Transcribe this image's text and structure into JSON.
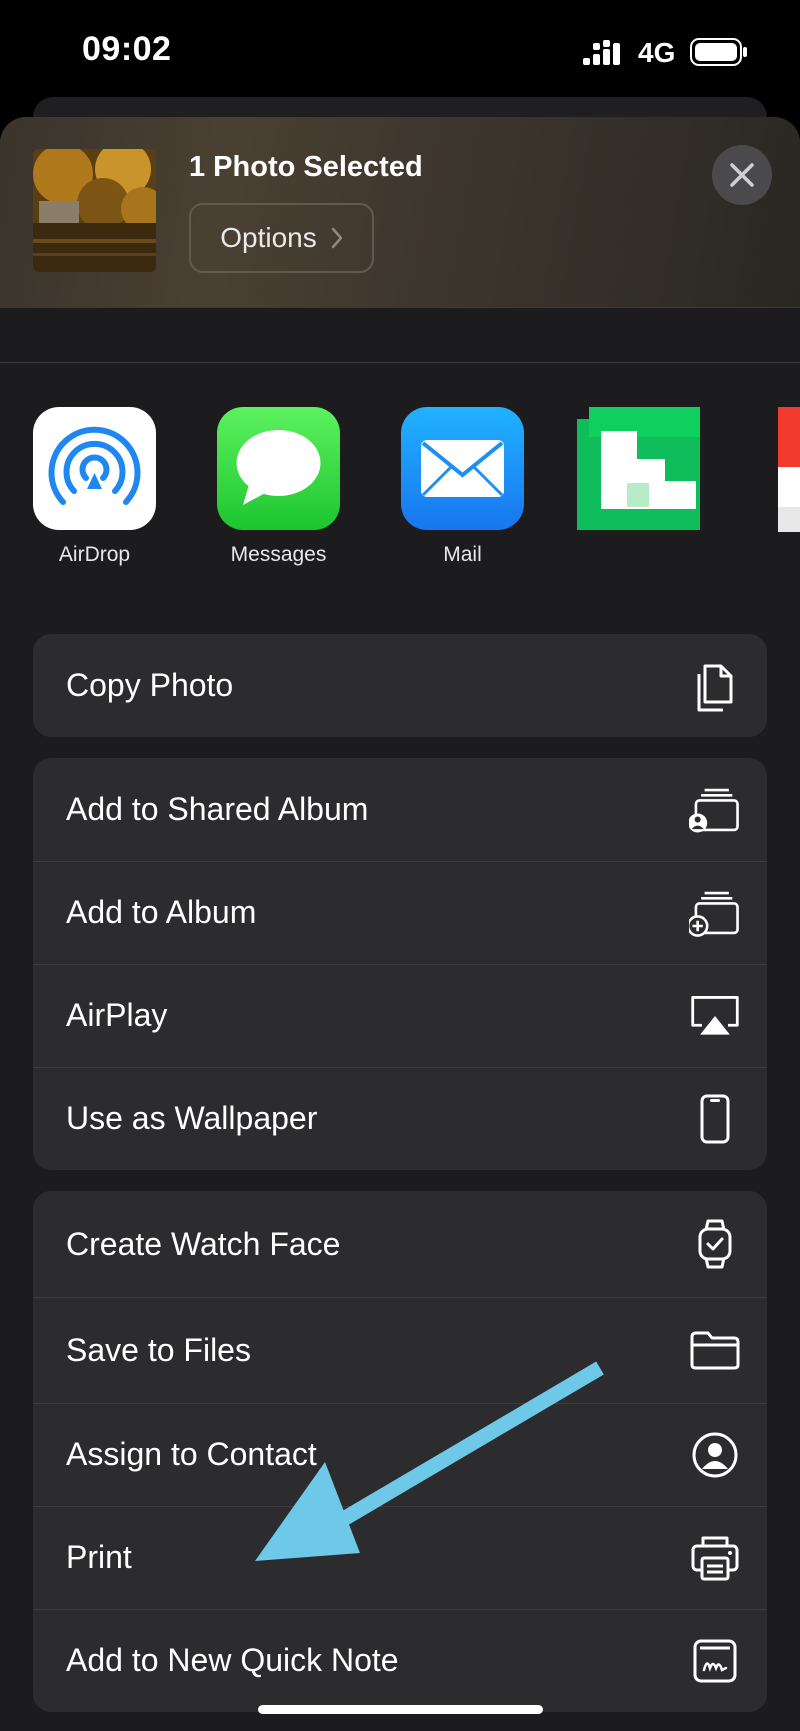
{
  "status": {
    "time": "09:02",
    "network": "4G"
  },
  "header": {
    "title": "1 Photo Selected",
    "options_label": "Options"
  },
  "apps": [
    {
      "label": "AirDrop",
      "icon": "airdrop-icon"
    },
    {
      "label": "Messages",
      "icon": "messages-icon"
    },
    {
      "label": "Mail",
      "icon": "mail-icon"
    }
  ],
  "groups": [
    [
      {
        "label": "Copy Photo",
        "icon": "copy-icon"
      }
    ],
    [
      {
        "label": "Add to Shared Album",
        "icon": "shared-album-icon"
      },
      {
        "label": "Add to Album",
        "icon": "add-album-icon"
      },
      {
        "label": "AirPlay",
        "icon": "airplay-icon"
      },
      {
        "label": "Use as Wallpaper",
        "icon": "phone-icon"
      }
    ],
    [
      {
        "label": "Create Watch Face",
        "icon": "watch-icon"
      },
      {
        "label": "Save to Files",
        "icon": "folder-icon"
      },
      {
        "label": "Assign to Contact",
        "icon": "contact-icon"
      },
      {
        "label": "Print",
        "icon": "printer-icon"
      },
      {
        "label": "Add to New Quick Note",
        "icon": "quick-note-icon"
      }
    ]
  ],
  "colors": {
    "annotation_arrow": "#6ec9e8",
    "sheet_bg": "#1c1c1e",
    "row_bg": "#2c2c2e"
  }
}
